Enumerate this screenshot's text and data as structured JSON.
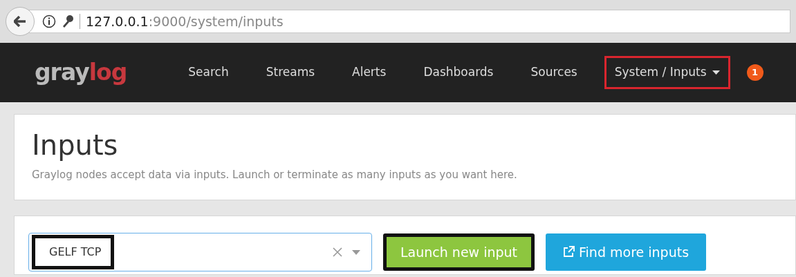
{
  "browser": {
    "url_host": "127.0.0.1",
    "url_path": ":9000/system/inputs"
  },
  "navbar": {
    "logo_left": "gray",
    "logo_right": "log",
    "items": [
      {
        "label": "Search",
        "dropdown": false,
        "highlighted": false
      },
      {
        "label": "Streams",
        "dropdown": false,
        "highlighted": false
      },
      {
        "label": "Alerts",
        "dropdown": false,
        "highlighted": false
      },
      {
        "label": "Dashboards",
        "dropdown": false,
        "highlighted": false
      },
      {
        "label": "Sources",
        "dropdown": false,
        "highlighted": false
      },
      {
        "label": "System / Inputs",
        "dropdown": true,
        "highlighted": true
      }
    ],
    "notification_count": "1"
  },
  "header": {
    "title": "Inputs",
    "description": "Graylog nodes accept data via inputs. Launch or terminate as many inputs as you want here."
  },
  "input_select": {
    "value": "GELF TCP",
    "highlighted": true
  },
  "buttons": [
    {
      "label": "Launch new input",
      "kind": "launch",
      "highlighted": true
    },
    {
      "label": "Find more inputs",
      "kind": "external",
      "highlighted": false
    }
  ]
}
